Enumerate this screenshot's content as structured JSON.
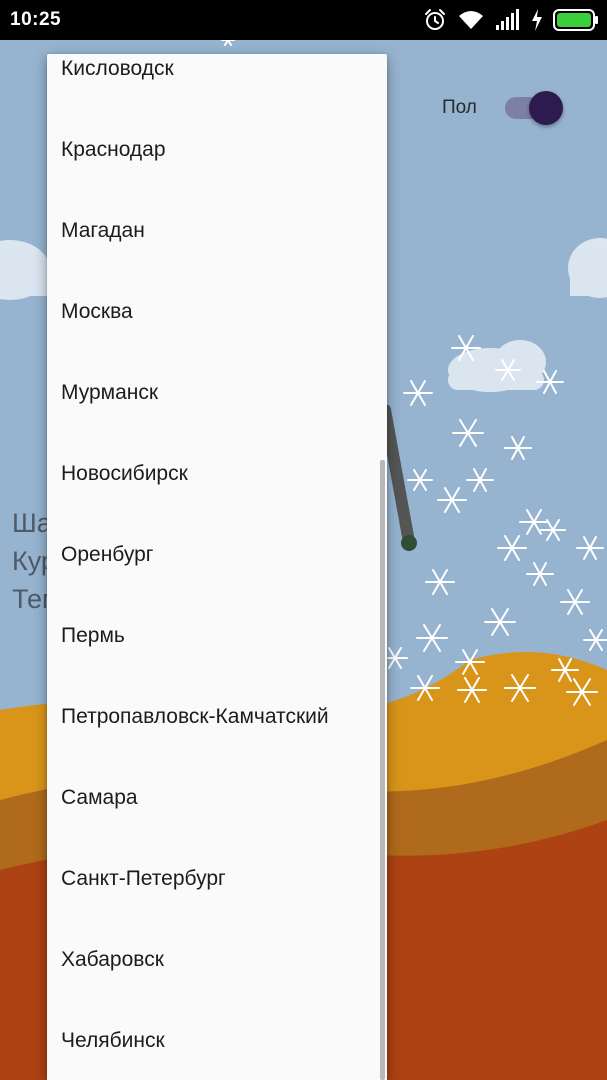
{
  "status_bar": {
    "time": "10:25",
    "icons": [
      "alarm-icon",
      "wifi-icon",
      "signal-icon",
      "charging-icon",
      "battery-icon"
    ],
    "battery_color": "#3ccf3c"
  },
  "background": {
    "toggle_label": "Пол",
    "toggle_on": true,
    "partial_lines": [
      "Ша",
      "Кур",
      "Тем"
    ],
    "sky_color": "#96b4d0"
  },
  "dropdown": {
    "items": [
      "Кисловодск",
      "Краснодар",
      "Магадан",
      "Москва",
      "Мурманск",
      "Новосибирск",
      "Оренбург",
      "Пермь",
      "Петропавловск-Камчатский",
      "Самара",
      "Санкт-Петербург",
      "Хабаровск",
      "Челябинск"
    ]
  }
}
